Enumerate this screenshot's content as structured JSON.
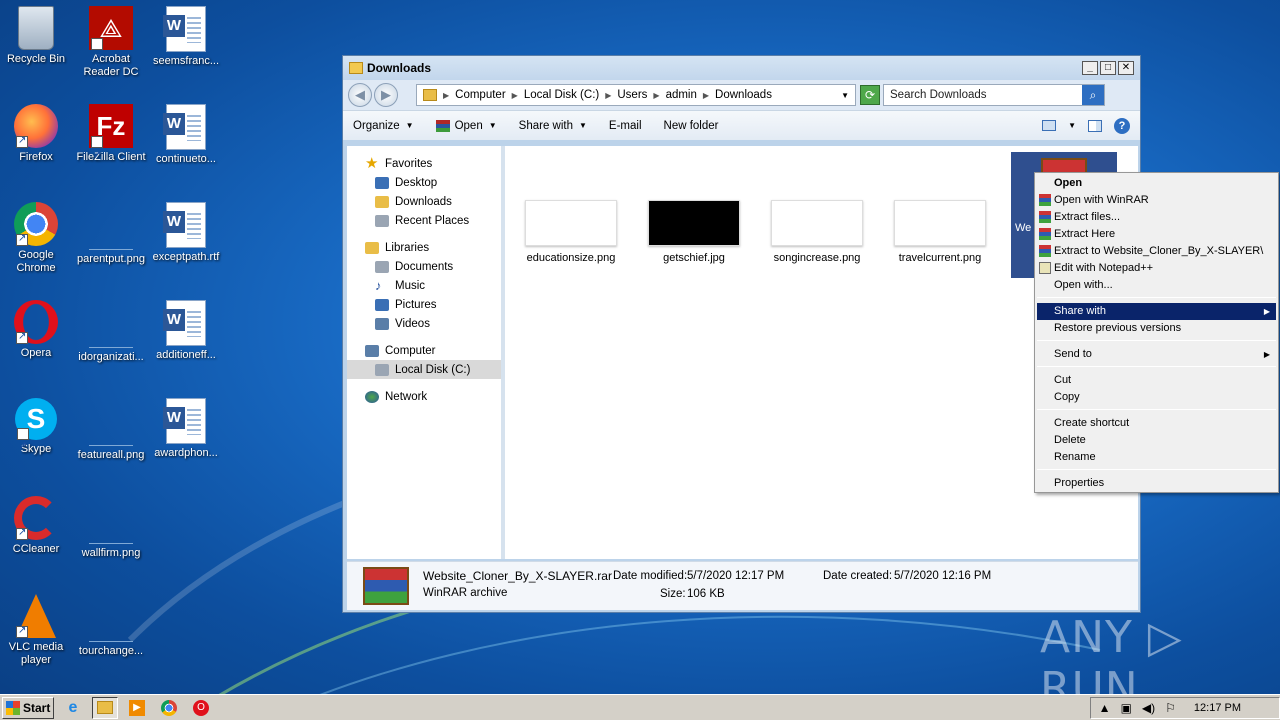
{
  "desktop": {
    "icons": [
      {
        "label": "Recycle Bin"
      },
      {
        "label": "Acrobat Reader DC"
      },
      {
        "label": "seemsfranc..."
      },
      {
        "label": "Firefox"
      },
      {
        "label": "FileZilla Client"
      },
      {
        "label": "continueto..."
      },
      {
        "label": "Google Chrome"
      },
      {
        "label": "parentput.png"
      },
      {
        "label": "exceptpath.rtf"
      },
      {
        "label": "Opera"
      },
      {
        "label": "idorganizati..."
      },
      {
        "label": "additioneff..."
      },
      {
        "label": "Skype"
      },
      {
        "label": "featureall.png"
      },
      {
        "label": "awardphon..."
      },
      {
        "label": "CCleaner"
      },
      {
        "label": "wallfirm.png"
      },
      {
        "label": "VLC media player"
      },
      {
        "label": "tourchange..."
      }
    ]
  },
  "window": {
    "title": "Downloads",
    "controls": {
      "minimize": "_",
      "maximize": "□",
      "close": "✕"
    },
    "address": {
      "crumbs": [
        "Computer",
        "Local Disk (C:)",
        "Users",
        "admin",
        "Downloads"
      ]
    },
    "search": {
      "placeholder": "Search Downloads"
    },
    "toolbar": {
      "organize": "Organize",
      "open": "Open",
      "share_with": "Share with",
      "email": "E-mail",
      "new_folder": "New folder"
    },
    "nav": {
      "favorites": "Favorites",
      "desktop": "Desktop",
      "downloads": "Downloads",
      "recent_places": "Recent Places",
      "libraries": "Libraries",
      "documents": "Documents",
      "music": "Music",
      "pictures": "Pictures",
      "videos": "Videos",
      "computer": "Computer",
      "local_disk": "Local Disk (C:)",
      "network": "Network"
    },
    "files": [
      {
        "name": "educationsize.png"
      },
      {
        "name": "getschief.jpg"
      },
      {
        "name": "songincrease.png"
      },
      {
        "name": "travelcurrent.png"
      }
    ],
    "selected_file_partial": "We",
    "details": {
      "name": "Website_Cloner_By_X-SLAYER.rar",
      "type": "WinRAR archive",
      "date_modified_label": "Date modified:",
      "date_modified": "5/7/2020 12:17 PM",
      "date_created_label": "Date created:",
      "date_created": "5/7/2020 12:16 PM",
      "size_label": "Size:",
      "size": "106 KB"
    }
  },
  "context_menu": {
    "open": "Open",
    "open_winrar": "Open with WinRAR",
    "extract_files": "Extract files...",
    "extract_here": "Extract Here",
    "extract_to": "Extract to Website_Cloner_By_X-SLAYER\\",
    "edit_notepad": "Edit with Notepad++",
    "open_with": "Open with...",
    "share_with": "Share with",
    "restore_versions": "Restore previous versions",
    "send_to": "Send to",
    "cut": "Cut",
    "copy": "Copy",
    "create_shortcut": "Create shortcut",
    "delete": "Delete",
    "rename": "Rename",
    "properties": "Properties"
  },
  "watermark": "ANY ▷ RUN",
  "taskbar": {
    "start": "Start",
    "clock": "12:17 PM"
  },
  "colors": {
    "menu_highlight": "#0a246a",
    "selection": "#2f4f8f",
    "desktop": "#1a6ec9"
  }
}
